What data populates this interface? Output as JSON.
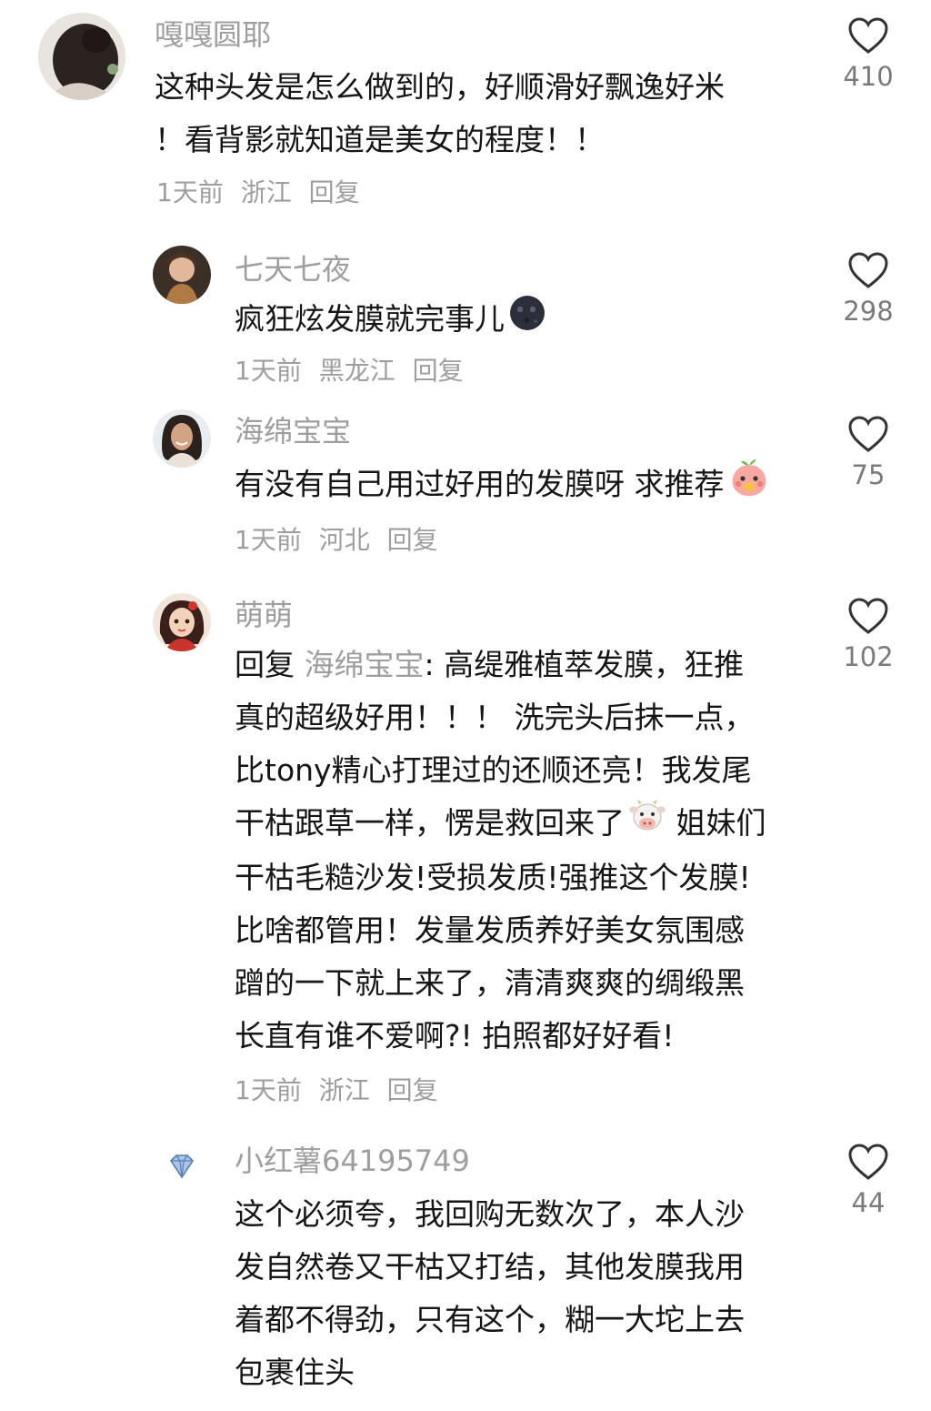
{
  "comments": [
    {
      "username": "嘎嘎圆耶",
      "lines": [
        "这种头发是怎么做到的，好顺滑好飘逸好米",
        "！看背影就知道是美女的程度！！"
      ],
      "time": "1天前",
      "location": "浙江",
      "reply_label": "回复",
      "likes": "410",
      "avatar_icon": "woman-back-hair-avatar"
    },
    {
      "username": "七天七夜",
      "lines": [
        "疯狂炫发膜就完事儿"
      ],
      "emoji": "new-moon-face-emoji",
      "time": "1天前",
      "location": "黑龙江",
      "reply_label": "回复",
      "likes": "298",
      "avatar_icon": "child-avatar"
    },
    {
      "username": "海绵宝宝",
      "lines": [
        "有没有自己用过好用的发膜呀 求推荐"
      ],
      "emoji": "peach-face-emoji",
      "time": "1天前",
      "location": "河北",
      "reply_label": "回复",
      "likes": "75",
      "avatar_icon": "smiling-woman-avatar"
    },
    {
      "username": "萌萌",
      "reply_prefix": "回复",
      "reply_to": "海绵宝宝",
      "first_line_rest": ": 高缇雅植萃发膜，狂推",
      "lines": [
        "真的超级好用！！！ 洗完头后抹一点，",
        "比tony精心打理过的还顺还亮！我发尾",
        "干枯跟草一样，愣是救回来了",
        "干枯毛糙沙发!受损发质!强推这个发膜!",
        "比啥都管用！发量发质养好美女氛围感",
        "蹭的一下就上来了，清清爽爽的绸缎黑",
        "长直有谁不爱啊?!  拍照都好好看!"
      ],
      "inline_after_line3": " 姐妹们",
      "emoji": "cow-face-emoji",
      "time": "1天前",
      "location": "浙江",
      "reply_label": "回复",
      "likes": "102",
      "avatar_icon": "cartoon-girl-avatar"
    },
    {
      "username": "小红薯64195749",
      "lines": [
        "这个必须夸，我回购无数次了，本人沙",
        "发自然卷又干枯又打结，其他发膜我用",
        "着都不得劲，只有这个，糊一大坨上去",
        "包裹住头"
      ],
      "likes": "44",
      "avatar_icon": "diamond-icon"
    }
  ]
}
